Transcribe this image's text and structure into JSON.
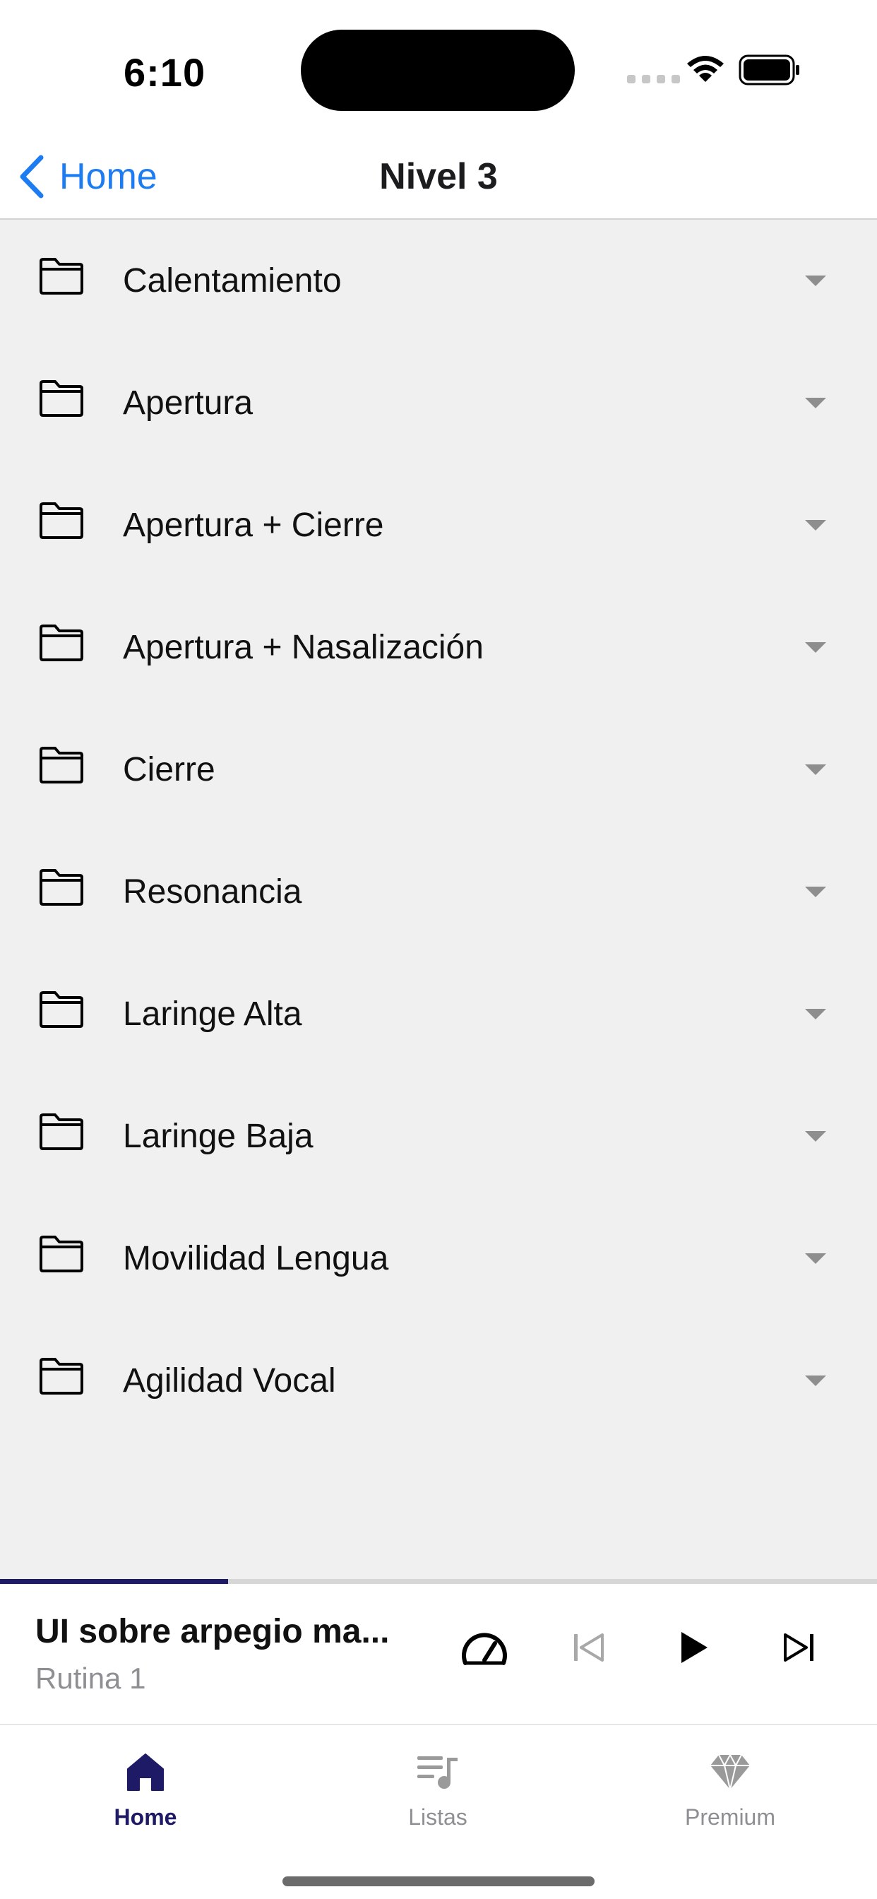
{
  "status_bar": {
    "time": "6:10"
  },
  "nav": {
    "back_label": "Home",
    "title": "Nivel 3",
    "accent": "#1e7cf2"
  },
  "categories": [
    {
      "label": "Calentamiento",
      "icon": "folder-icon"
    },
    {
      "label": "Apertura",
      "icon": "folder-icon"
    },
    {
      "label": "Apertura + Cierre",
      "icon": "folder-icon"
    },
    {
      "label": "Apertura + Nasalización",
      "icon": "folder-icon"
    },
    {
      "label": "Cierre",
      "icon": "folder-icon"
    },
    {
      "label": "Resonancia",
      "icon": "folder-icon"
    },
    {
      "label": "Laringe Alta",
      "icon": "folder-icon"
    },
    {
      "label": "Laringe Baja",
      "icon": "folder-icon"
    },
    {
      "label": "Movilidad Lengua",
      "icon": "folder-icon"
    },
    {
      "label": "Agilidad Vocal",
      "icon": "folder-icon"
    }
  ],
  "player": {
    "title": "UI sobre arpegio ma...",
    "subtitle": "Rutina 1",
    "progress_fraction": 0.26,
    "progress_color": "#1f1a66",
    "controls": [
      "speed-icon",
      "previous-icon",
      "play-icon",
      "next-icon"
    ]
  },
  "tabs": [
    {
      "label": "Home",
      "icon": "home-icon",
      "active": true
    },
    {
      "label": "Listas",
      "icon": "playlist-icon",
      "active": false
    },
    {
      "label": "Premium",
      "icon": "diamond-icon",
      "active": false
    }
  ]
}
